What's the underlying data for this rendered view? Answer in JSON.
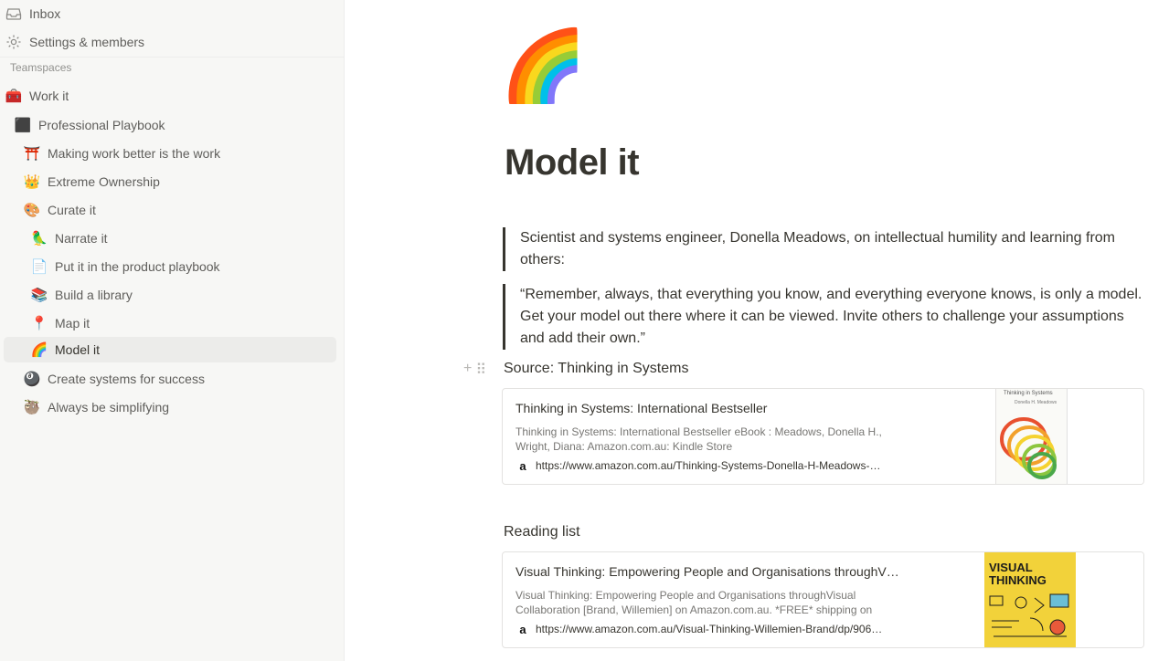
{
  "sidebar": {
    "top_items": [
      {
        "label": "Inbox",
        "icon": "inbox-icon"
      },
      {
        "label": "Settings & members",
        "icon": "gear-icon"
      }
    ],
    "section_label": "Teamspaces",
    "teamspace": {
      "label": "Work it",
      "icon": "🧰"
    },
    "pages": [
      {
        "label": "Professional Playbook",
        "icon": "⬛"
      },
      {
        "label": "Making work better is the work",
        "icon": "⛩️"
      },
      {
        "label": "Extreme Ownership",
        "icon": "👑"
      },
      {
        "label": "Curate it",
        "icon": "🎨"
      },
      {
        "label": "Narrate it",
        "icon": "🦜"
      },
      {
        "label": "Put it in the product playbook",
        "icon": "📄"
      },
      {
        "label": "Build a library",
        "icon": "📚"
      },
      {
        "label": "Map it",
        "icon": "📍"
      },
      {
        "label": "Model it",
        "icon": "🌈"
      },
      {
        "label": "Create systems for success",
        "icon": "🎱"
      },
      {
        "label": "Always be simplifying",
        "icon": "🦥"
      }
    ]
  },
  "page": {
    "icon": "🌈",
    "title": "Model it",
    "quote1": "Scientist and systems engineer, Donella Meadows, on intellectual humility and learning from others:",
    "quote2": "“Remember, always, that everything you know, and everything everyone knows, is only a model. Get your model out there where it can be viewed. Invite others to challenge your assumptions and add their own.”",
    "source": "Source: Thinking in Systems",
    "bookmark1": {
      "title": "Thinking in Systems: International Bestseller",
      "description": "Thinking in Systems: International Bestseller eBook : Meadows, Donella H., Wright, Diana: Amazon.com.au: Kindle Store",
      "favicon": "a",
      "url": "https://www.amazon.com.au/Thinking-Systems-Donella-H-Meadows-…",
      "cover_title": "Thinking in Systems",
      "cover_author": "Donella H. Meadows"
    },
    "reading_list": "Reading list",
    "bookmark2": {
      "title": "Visual Thinking: Empowering People and Organisations throughV…",
      "description": "Visual Thinking: Empowering People and Organisations throughVisual Collaboration [Brand, Willemien] on Amazon.com.au. *FREE* shipping on",
      "favicon": "a",
      "url": "https://www.amazon.com.au/Visual-Thinking-Willemien-Brand/dp/906…",
      "cover_title": "VISUAL THINKING"
    }
  }
}
